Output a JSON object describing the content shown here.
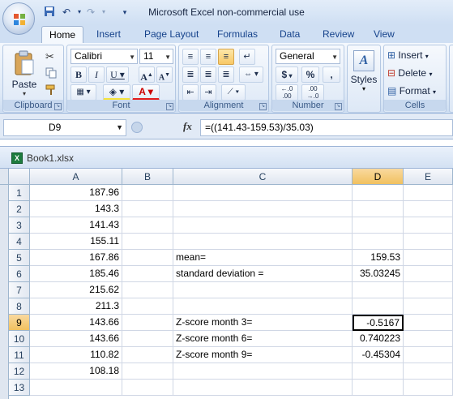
{
  "window": {
    "title": "Microsoft Excel non-commercial use"
  },
  "tabs": [
    "Home",
    "Insert",
    "Page Layout",
    "Formulas",
    "Data",
    "Review",
    "View"
  ],
  "ribbon": {
    "clipboard": {
      "label": "Clipboard",
      "paste": "Paste"
    },
    "font": {
      "label": "Font",
      "font_name": "Calibri",
      "font_size": "11"
    },
    "alignment": {
      "label": "Alignment"
    },
    "number": {
      "label": "Number",
      "format": "General",
      "currency": "$",
      "percent": "%",
      "comma": ","
    },
    "styles": {
      "label": "Styles"
    },
    "cells": {
      "label": "Cells",
      "insert": "Insert",
      "delete": "Delete",
      "format": "Format"
    }
  },
  "formula_bar": {
    "name_box": "D9",
    "fx": "fx",
    "formula": "=((141.43-159.53)/35.03)"
  },
  "workbook": {
    "title": "Book1.xlsx"
  },
  "columns": [
    "A",
    "B",
    "C",
    "D",
    "E"
  ],
  "rows": [
    {
      "n": "1",
      "A": "187.96",
      "C": "",
      "D": ""
    },
    {
      "n": "2",
      "A": "143.3",
      "C": "",
      "D": ""
    },
    {
      "n": "3",
      "A": "141.43",
      "C": "",
      "D": ""
    },
    {
      "n": "4",
      "A": "155.11",
      "C": "",
      "D": ""
    },
    {
      "n": "5",
      "A": "167.86",
      "C": "mean=",
      "D": "159.53"
    },
    {
      "n": "6",
      "A": "185.46",
      "C": "standard deviation =",
      "D": "35.03245"
    },
    {
      "n": "7",
      "A": "215.62",
      "C": "",
      "D": ""
    },
    {
      "n": "8",
      "A": "211.3",
      "C": "",
      "D": ""
    },
    {
      "n": "9",
      "A": "143.66",
      "C": "Z-score month 3=",
      "D": "-0.5167"
    },
    {
      "n": "10",
      "A": "143.66",
      "C": "Z-score month 6=",
      "D": "0.740223"
    },
    {
      "n": "11",
      "A": "110.82",
      "C": "Z-score month 9=",
      "D": "-0.45304"
    },
    {
      "n": "12",
      "A": "108.18",
      "C": "",
      "D": ""
    },
    {
      "n": "13",
      "A": "",
      "C": "",
      "D": ""
    }
  ],
  "selected": {
    "column": "D",
    "row": "9"
  }
}
